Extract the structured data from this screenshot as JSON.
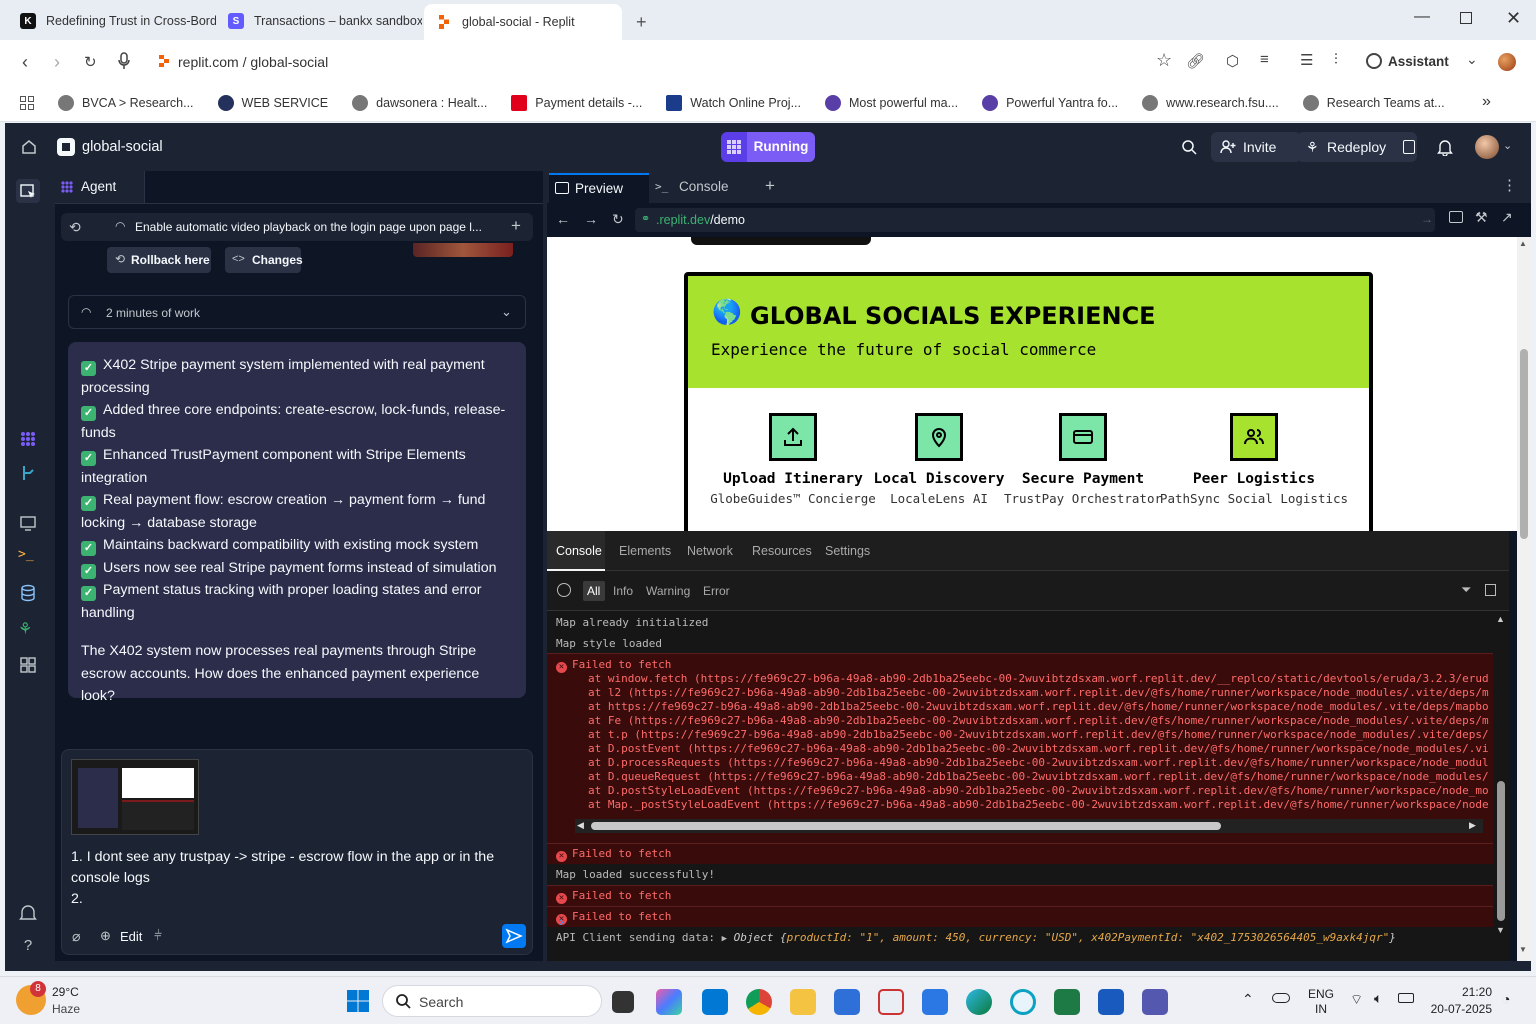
{
  "browser": {
    "tabs": [
      {
        "title": "Redefining Trust in Cross-Bord",
        "icon": "K",
        "color": "#111"
      },
      {
        "title": "Transactions – bankx sandbox",
        "icon": "S",
        "color": "#635bff"
      },
      {
        "title": "global-social - Replit",
        "icon": "",
        "color": "#f26207"
      }
    ],
    "url_host": "replit.com",
    "url_path": " / global-social",
    "assistant_label": "Assistant",
    "bookmarks": [
      "BVCA > Research...",
      "WEB SERVICE",
      "dawsonera : Healt...",
      "Payment details -...",
      "Watch Online Proj...",
      "Most powerful ma...",
      "Powerful Yantra fo...",
      "www.research.fsu....",
      "Research Teams at..."
    ]
  },
  "app": {
    "project_name": "global-social",
    "run_label": "Running",
    "invite_label": "Invite",
    "redeploy_label": "Redeploy",
    "agent_tab": "Agent",
    "checkpoint_text": "Enable automatic video playback on the login page upon page l...",
    "rollback_label": "Rollback here",
    "changes_label": "Changes",
    "work_time": "2 minutes of work",
    "checklist": [
      "X402 Stripe payment system implemented with real payment processing",
      "Added three core endpoints: create-escrow, lock-funds, release-funds",
      "Enhanced TrustPayment component with Stripe Elements integration",
      "Real payment flow: escrow creation → payment form → fund locking → database storage",
      "Maintains backward compatibility with existing mock system",
      "Users now see real Stripe payment forms instead of simulation",
      "Payment status tracking with proper loading states and error handling"
    ],
    "summary": "The X402 system now processes real payments through Stripe escrow accounts. How does the enhanced payment experience look?",
    "input_line1": "1. I dont see any trustpay -> stripe - escrow flow in the app or in the console logs",
    "input_line2": "2.",
    "edit_label": "Edit"
  },
  "preview": {
    "tab_preview": "Preview",
    "tab_console": "Console",
    "url_host": ".replit.dev",
    "url_path": "/demo",
    "hero_title": "GLOBAL SOCIALS EXPERIENCE",
    "hero_emoji": "🌎",
    "hero_subtitle": "Experience the future of social commerce",
    "features": [
      {
        "title": "Upload Itinerary",
        "subtitle": "GlobeGuides™ Concierge",
        "icon": "upload-icon"
      },
      {
        "title": "Local Discovery",
        "subtitle": "LocaleLens AI",
        "icon": "map-pin-icon"
      },
      {
        "title": "Secure Payment",
        "subtitle": "TrustPay Orchestrator",
        "icon": "credit-card-icon"
      },
      {
        "title": "Peer Logistics",
        "subtitle": "PathSync Social Logistics",
        "icon": "users-icon"
      }
    ]
  },
  "devtools": {
    "tabs": [
      "Console",
      "Elements",
      "Network",
      "Resources",
      "Settings"
    ],
    "filters": [
      "All",
      "Info",
      "Warning",
      "Error"
    ],
    "log_map_initialized": "Map already initialized",
    "log_style_loaded": "Map style loaded",
    "error_text": "Failed to fetch",
    "stack": [
      "at window.fetch (https://fe969c27-b96a-49a8-ab90-2db1ba25eebc-00-2wuvibtzdsxam.worf.replit.dev/__replco/static/devtools/eruda/3.2.3/erud",
      "at l2 (https://fe969c27-b96a-49a8-ab90-2db1ba25eebc-00-2wuvibtzdsxam.worf.replit.dev/@fs/home/runner/workspace/node_modules/.vite/deps/m",
      "at https://fe969c27-b96a-49a8-ab90-2db1ba25eebc-00-2wuvibtzdsxam.worf.replit.dev/@fs/home/runner/workspace/node_modules/.vite/deps/mapbo",
      "at Fe (https://fe969c27-b96a-49a8-ab90-2db1ba25eebc-00-2wuvibtzdsxam.worf.replit.dev/@fs/home/runner/workspace/node_modules/.vite/deps/m",
      "at t.p (https://fe969c27-b96a-49a8-ab90-2db1ba25eebc-00-2wuvibtzdsxam.worf.replit.dev/@fs/home/runner/workspace/node_modules/.vite/deps/",
      "at D.postEvent (https://fe969c27-b96a-49a8-ab90-2db1ba25eebc-00-2wuvibtzdsxam.worf.replit.dev/@fs/home/runner/workspace/node_modules/.vi",
      "at D.processRequests (https://fe969c27-b96a-49a8-ab90-2db1ba25eebc-00-2wuvibtzdsxam.worf.replit.dev/@fs/home/runner/workspace/node_modul",
      "at D.queueRequest (https://fe969c27-b96a-49a8-ab90-2db1ba25eebc-00-2wuvibtzdsxam.worf.replit.dev/@fs/home/runner/workspace/node_modules/",
      "at D.postStyleLoadEvent (https://fe969c27-b96a-49a8-ab90-2db1ba25eebc-00-2wuvibtzdsxam.worf.replit.dev/@fs/home/runner/workspace/node_mo",
      "at Map._postStyleLoadEvent (https://fe969c27-b96a-49a8-ab90-2db1ba25eebc-00-2wuvibtzdsxam.worf.replit.dev/@fs/home/runner/workspace/node"
    ],
    "log_map_loaded": "Map loaded successfully!",
    "api_label": "API Client sending data:",
    "api_object_prefix": "Object {",
    "api_object_body": "productId: \"1\", amount: 450, currency: \"USD\", x402PaymentId: \"x402_1753026564405_w9axk4jqr\"",
    "api_object_suffix": "}"
  },
  "taskbar": {
    "weather_temp": "29°C",
    "weather_desc": "Haze",
    "weather_badge": "8",
    "search_label": "Search",
    "lang_line1": "ENG",
    "lang_line2": "IN",
    "time": "21:20",
    "date": "20-07-2025"
  }
}
